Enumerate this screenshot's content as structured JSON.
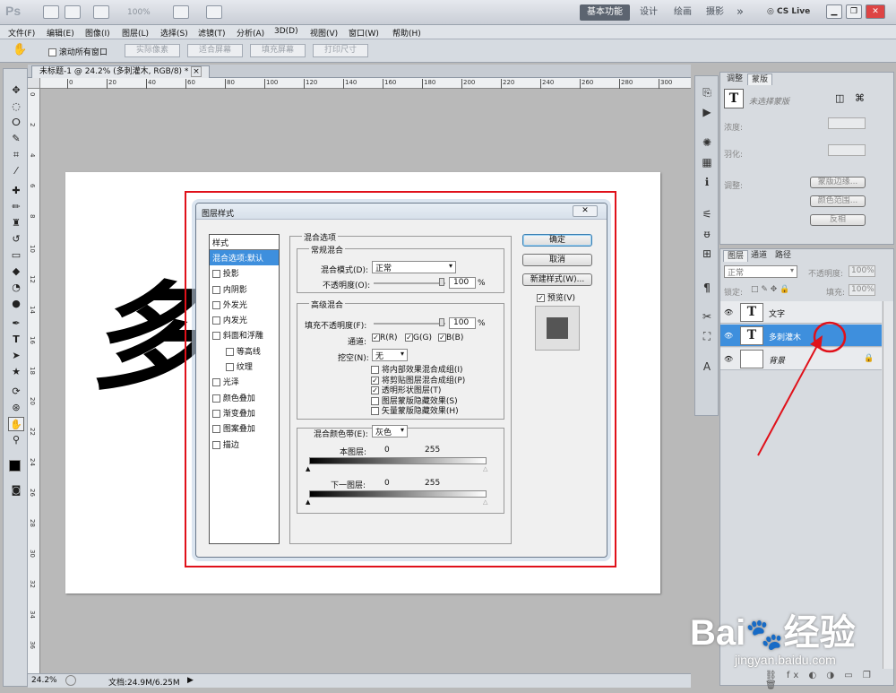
{
  "app": {
    "logo": "Ps",
    "zoom_display": "100%"
  },
  "workspaces": {
    "basic": "基本功能",
    "design": "设计",
    "painting": "绘画",
    "photo": "摄影",
    "more": "»",
    "cslive": "CS Live"
  },
  "menu": [
    "文件(F)",
    "编辑(E)",
    "图像(I)",
    "图层(L)",
    "选择(S)",
    "滤镜(T)",
    "分析(A)",
    "3D(D)",
    "视图(V)",
    "窗口(W)",
    "帮助(H)"
  ],
  "options": {
    "scroll_all": "滚动所有窗口",
    "actual_pixels": "实际像素",
    "fit_screen": "适合屏幕",
    "fill_screen": "填充屏幕",
    "print_size": "打印尺寸"
  },
  "document": {
    "tab_title": "未标题-1 @ 24.2% (多刺灌木, RGB/8) *",
    "close": "×"
  },
  "ruler": {
    "h_labels": [
      "0",
      "20",
      "40",
      "60",
      "80",
      "100",
      "120",
      "140",
      "160",
      "180",
      "200",
      "220",
      "240",
      "260",
      "280",
      "300"
    ],
    "v_labels": [
      "0",
      "2",
      "4",
      "6",
      "8",
      "10",
      "12",
      "14",
      "16",
      "18",
      "20",
      "22",
      "24",
      "26",
      "28",
      "30",
      "32",
      "34",
      "36"
    ]
  },
  "canvas": {
    "text": "多刺灌木",
    "bg_color": "#ffffff"
  },
  "status": {
    "zoom": "24.2%",
    "doc_info": "文档:24.9M/6.25M"
  },
  "dialog": {
    "title": "图层样式",
    "close": "✕",
    "styles_header": "样式",
    "styles": [
      {
        "label": "混合选项:默认",
        "selected": true,
        "has_checkbox": false,
        "indent": false
      },
      {
        "label": "投影",
        "has_checkbox": true,
        "indent": false
      },
      {
        "label": "内阴影",
        "has_checkbox": true,
        "indent": false
      },
      {
        "label": "外发光",
        "has_checkbox": true,
        "indent": false
      },
      {
        "label": "内发光",
        "has_checkbox": true,
        "indent": false
      },
      {
        "label": "斜面和浮雕",
        "has_checkbox": true,
        "indent": false
      },
      {
        "label": "等高线",
        "has_checkbox": true,
        "indent": true
      },
      {
        "label": "纹理",
        "has_checkbox": true,
        "indent": true
      },
      {
        "label": "光泽",
        "has_checkbox": true,
        "indent": false
      },
      {
        "label": "颜色叠加",
        "has_checkbox": true,
        "indent": false
      },
      {
        "label": "渐变叠加",
        "has_checkbox": true,
        "indent": false
      },
      {
        "label": "图案叠加",
        "has_checkbox": true,
        "indent": false
      },
      {
        "label": "描边",
        "has_checkbox": true,
        "indent": false
      }
    ],
    "blend_options_title": "混合选项",
    "general": {
      "title": "常规混合",
      "mode_label": "混合模式(D):",
      "mode_value": "正常",
      "opacity_label": "不透明度(O):",
      "opacity_value": "100",
      "pct": "%"
    },
    "advanced": {
      "title": "高级混合",
      "fill_label": "填充不透明度(F):",
      "fill_value": "100",
      "pct": "%",
      "channels_label": "通道:",
      "ch_r": "R(R)",
      "ch_g": "G(G)",
      "ch_b": "B(B)",
      "knockout_label": "挖空(N):",
      "knockout_value": "无",
      "opts": [
        {
          "label": "将内部效果混合成组(I)",
          "checked": false
        },
        {
          "label": "将剪贴图层混合成组(P)",
          "checked": true
        },
        {
          "label": "透明形状图层(T)",
          "checked": true
        },
        {
          "label": "图层蒙版隐藏效果(S)",
          "checked": false
        },
        {
          "label": "矢量蒙版隐藏效果(H)",
          "checked": false
        }
      ]
    },
    "blend_if": {
      "label": "混合颜色带(E):",
      "value": "灰色",
      "this_layer": "本图层:",
      "underlying": "下一图层:",
      "min": "0",
      "max": "255"
    },
    "buttons": {
      "ok": "确定",
      "cancel": "取消",
      "new_style": "新建样式(W)...",
      "preview": "预览(V)"
    }
  },
  "adjustments": {
    "tab_adjust": "调整",
    "tab_masks": "蒙版",
    "no_mask": "未选择蒙版",
    "density": "浓度:",
    "feather": "羽化:",
    "refine": "调整:",
    "mask_edge": "蒙版边缘...",
    "color_range": "颜色范围...",
    "invert": "反相"
  },
  "layers": {
    "tab_layers": "图层",
    "tab_channels": "通道",
    "tab_paths": "路径",
    "blend_mode": "正常",
    "opacity_label": "不透明度:",
    "opacity_value": "100%",
    "lock_label": "锁定:",
    "fill_label": "填充:",
    "fill_value": "100%",
    "items": [
      {
        "name": "文字",
        "thumb": "T",
        "selected": false
      },
      {
        "name": "多刺灌木",
        "thumb": "T",
        "selected": true
      },
      {
        "name": "背景",
        "thumb": "",
        "selected": false,
        "locked": true
      }
    ]
  },
  "watermark": {
    "brand": "Bai",
    "brand2": "经验",
    "url": "jingyan.baidu.com"
  },
  "annotation_color": "#e0111a"
}
